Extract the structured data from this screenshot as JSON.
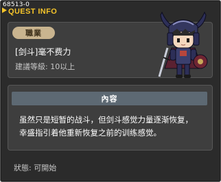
{
  "window": {
    "quest_id": "68513-0",
    "title": "QUEST INFO"
  },
  "quest": {
    "job_label": "職業",
    "name": "[剑斗]毫不费力",
    "recommended_level": "建議等級: 10以上",
    "content_header": "內容",
    "description_line1": "虽然只是短暂的战斗，但剑斗感觉力量逐渐恢复，",
    "description_line2": "幸盛指引着他重新恢复之前的训练感觉。",
    "status": "狀態:  可開始"
  },
  "colors": {
    "title": "#f6c52a",
    "panel": "#3e3e3e",
    "header_bar": "#5d6973",
    "badge": "#c9b48f"
  }
}
